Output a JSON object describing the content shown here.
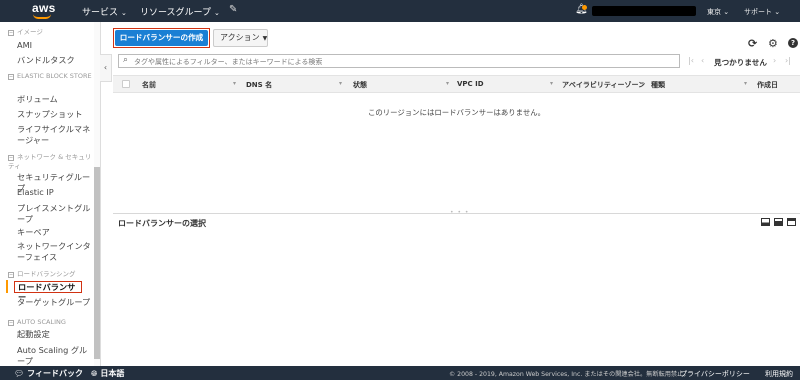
{
  "topnav": {
    "logo": "aws",
    "services": "サービス",
    "resource_groups": "リソースグループ",
    "pin_icon": "pin-icon",
    "region": "東京",
    "support": "サポート",
    "notification_dot_color": "#ff9900"
  },
  "sidebar": {
    "sections": [
      {
        "label": "イメージ",
        "items": [
          "AMI",
          "バンドルタスク"
        ]
      },
      {
        "label": "ELASTIC BLOCK STORE",
        "items": [
          "ボリューム",
          "スナップショット",
          "ライフサイクルマネージャー"
        ]
      },
      {
        "label": "ネットワーク & セキュリティ",
        "items": [
          "セキュリティグループ",
          "Elastic IP",
          "プレイスメントグループ",
          "キーペア",
          "ネットワークインターフェイス"
        ]
      },
      {
        "label": "ロードバランシング",
        "items": [
          "ロードバランサー",
          "ターゲットグループ"
        ]
      },
      {
        "label": "AUTO SCALING",
        "items": [
          "起動設定",
          "Auto Scaling グループ"
        ]
      }
    ],
    "active_item": "ロードバランサー"
  },
  "toolbar": {
    "create_label": "ロードバランサーの作成",
    "actions_label": "アクション",
    "refresh_icon": "refresh-icon",
    "settings_icon": "gear-icon",
    "help_icon": "help-icon"
  },
  "filter": {
    "placeholder": "タグや属性によるフィルター、またはキーワードによる検索",
    "not_found": "見つかりません"
  },
  "table": {
    "columns": [
      "名前",
      "DNS 名",
      "状態",
      "VPC ID",
      "アベイラビリティーゾーン",
      "種類",
      "作成日"
    ],
    "empty_message": "このリージョンにはロードバランサーはありません。"
  },
  "detail": {
    "title": "ロードバランサーの選択"
  },
  "footer": {
    "feedback": "フィードバック",
    "language": "日本語",
    "copyright": "© 2008 - 2019, Amazon Web Services, Inc. またはその関連会社。無断転用禁止。",
    "privacy": "プライバシーポリシー",
    "terms": "利用規約"
  },
  "colors": {
    "primary_button": "#1a7fd4",
    "highlight_border": "#d13212",
    "nav_bg": "#232f3e",
    "accent": "#ff9900"
  }
}
